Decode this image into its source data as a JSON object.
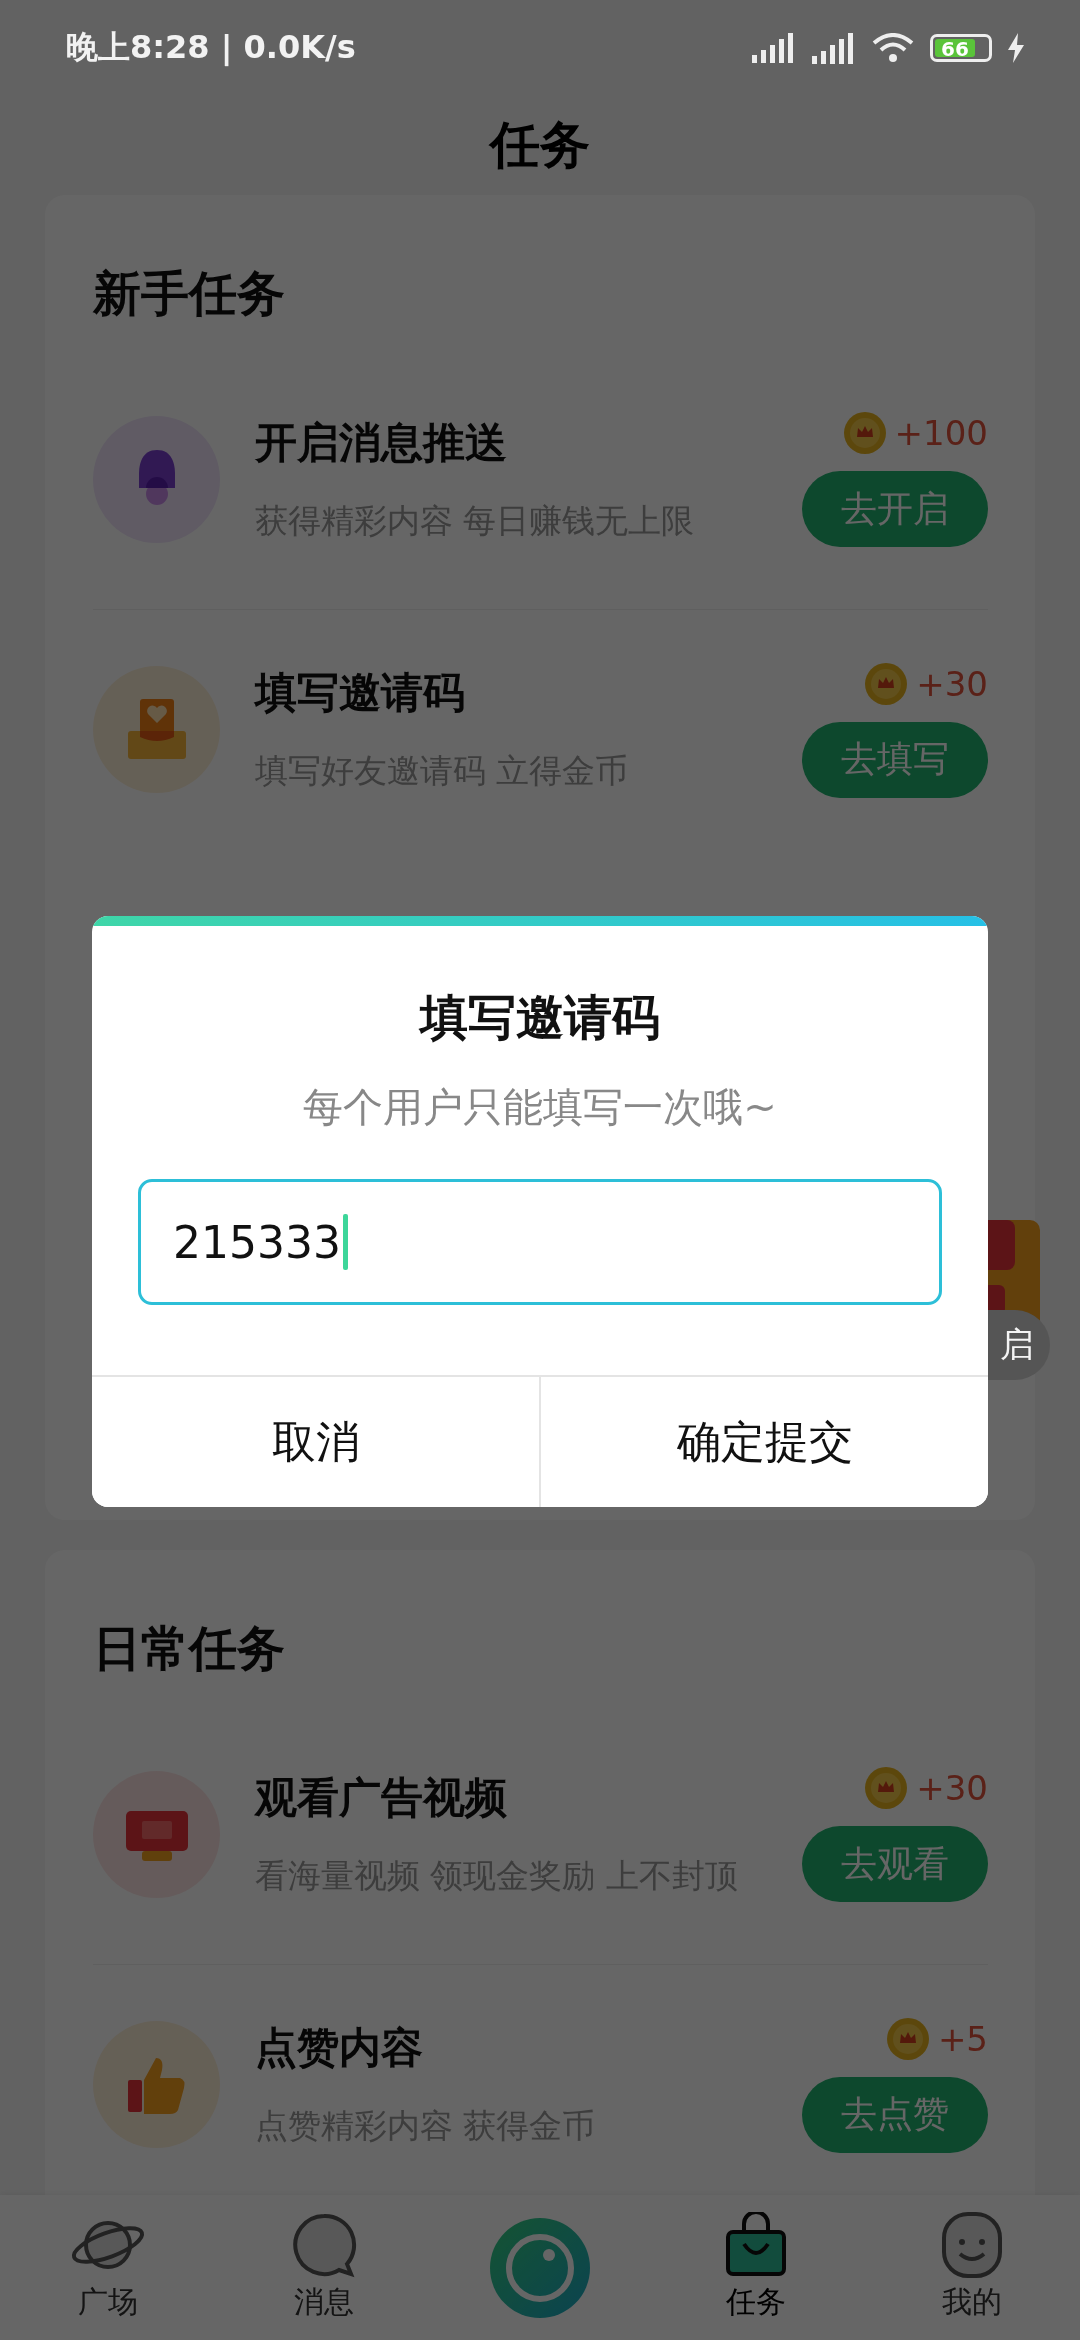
{
  "status_bar": {
    "time": "晚上8:28 | 0.0K/s",
    "battery": "66"
  },
  "header": {
    "title": "任务"
  },
  "sections": [
    {
      "title": "新手任务",
      "tasks": [
        {
          "kind": "bell",
          "title": "开启消息推送",
          "subtitle": "获得精彩内容 每日赚钱无上限",
          "reward": "+100",
          "button": "去开启"
        },
        {
          "kind": "envelope",
          "title": "填写邀请码",
          "subtitle": "填写好友邀请码 立得金币",
          "reward": "+30",
          "button": "去填写"
        }
      ]
    },
    {
      "title": "日常任务",
      "tasks": [
        {
          "kind": "ad",
          "title": "观看广告视频",
          "subtitle": "看海量视频 领现金奖励 上不封顶",
          "reward": "+30",
          "button": "去观看"
        },
        {
          "kind": "thumb",
          "title": "点赞内容",
          "subtitle": "点赞精彩内容 获得金币",
          "reward": "+5",
          "button": "去点赞"
        }
      ]
    }
  ],
  "peek_button": {
    "label": "启"
  },
  "dialog": {
    "title": "填写邀请码",
    "subtitle": "每个用户只能填写一次哦~",
    "input_value": "215333",
    "buttons": [
      {
        "label": "取消"
      },
      {
        "label": "确定提交"
      }
    ]
  },
  "bottom_nav": [
    {
      "kind": "planet",
      "label": "广场",
      "selected": false
    },
    {
      "kind": "chat",
      "label": "消息",
      "selected": false
    },
    {
      "kind": "camera"
    },
    {
      "kind": "bag",
      "label": "任务",
      "selected": true
    },
    {
      "kind": "face",
      "label": "我的",
      "selected": false
    }
  ]
}
